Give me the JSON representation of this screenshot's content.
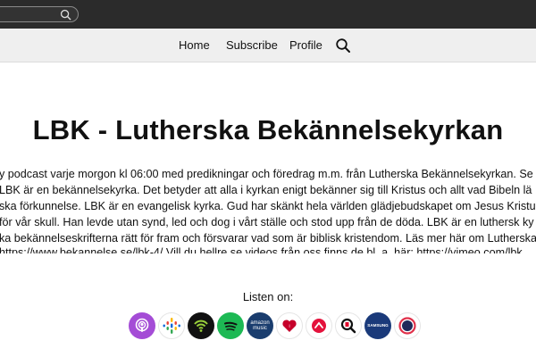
{
  "search": {
    "placeholder": ""
  },
  "nav": {
    "items": [
      {
        "label": "Home"
      },
      {
        "label": "Subscribe"
      },
      {
        "label": "Profile"
      }
    ]
  },
  "podcast": {
    "title": "LBK - Lutherska Bekännelsekyrkan",
    "description_lines": [
      "y podcast varje morgon kl 06:00 med predikningar och föredrag m.m. från Lutherska Bekännelsekyrkan. Se",
      "LBK är en bekännelsekyrka. Det betyder att alla i kyrkan enigt bekänner sig till Kristus och allt vad Bibeln lä",
      "ska förkunnelse. LBK är en evangelisk kyrka. Gud har skänkt hela världen glädjebudskapet om Jesus Kristus",
      "för vår skull. Han levde utan synd, led och dog i vårt ställe och stod upp från de döda. LBK är en luthersk ky",
      "ka bekännelseskrifterna rätt för fram och försvarar vad som är biblisk kristendom. Läs mer här om Lutherska",
      "https://www.bekannelse.se/lbk-4/ Vill du hellre se videos från oss finns de bl. a. här: https://vimeo.com/lbk"
    ]
  },
  "listen": {
    "label": "Listen on:",
    "platforms": [
      {
        "name": "apple-podcasts-icon",
        "color": "#a44cd6"
      },
      {
        "name": "google-podcasts-icon",
        "color": "#ffffff"
      },
      {
        "name": "podcast-addict-icon",
        "color": "#111111"
      },
      {
        "name": "spotify-icon",
        "color": "#1db954"
      },
      {
        "name": "amazon-music-icon",
        "color": "#1a3d6e",
        "text": "amazon music"
      },
      {
        "name": "iheartradio-icon",
        "color": "#ffffff"
      },
      {
        "name": "castbox-icon",
        "color": "#ffffff"
      },
      {
        "name": "podcast-index-icon",
        "color": "#ffffff"
      },
      {
        "name": "samsung-podcasts-icon",
        "color": "#1a3a7a",
        "text": "SAMSUNG"
      },
      {
        "name": "podchaser-icon",
        "color": "#ffffff"
      }
    ]
  }
}
